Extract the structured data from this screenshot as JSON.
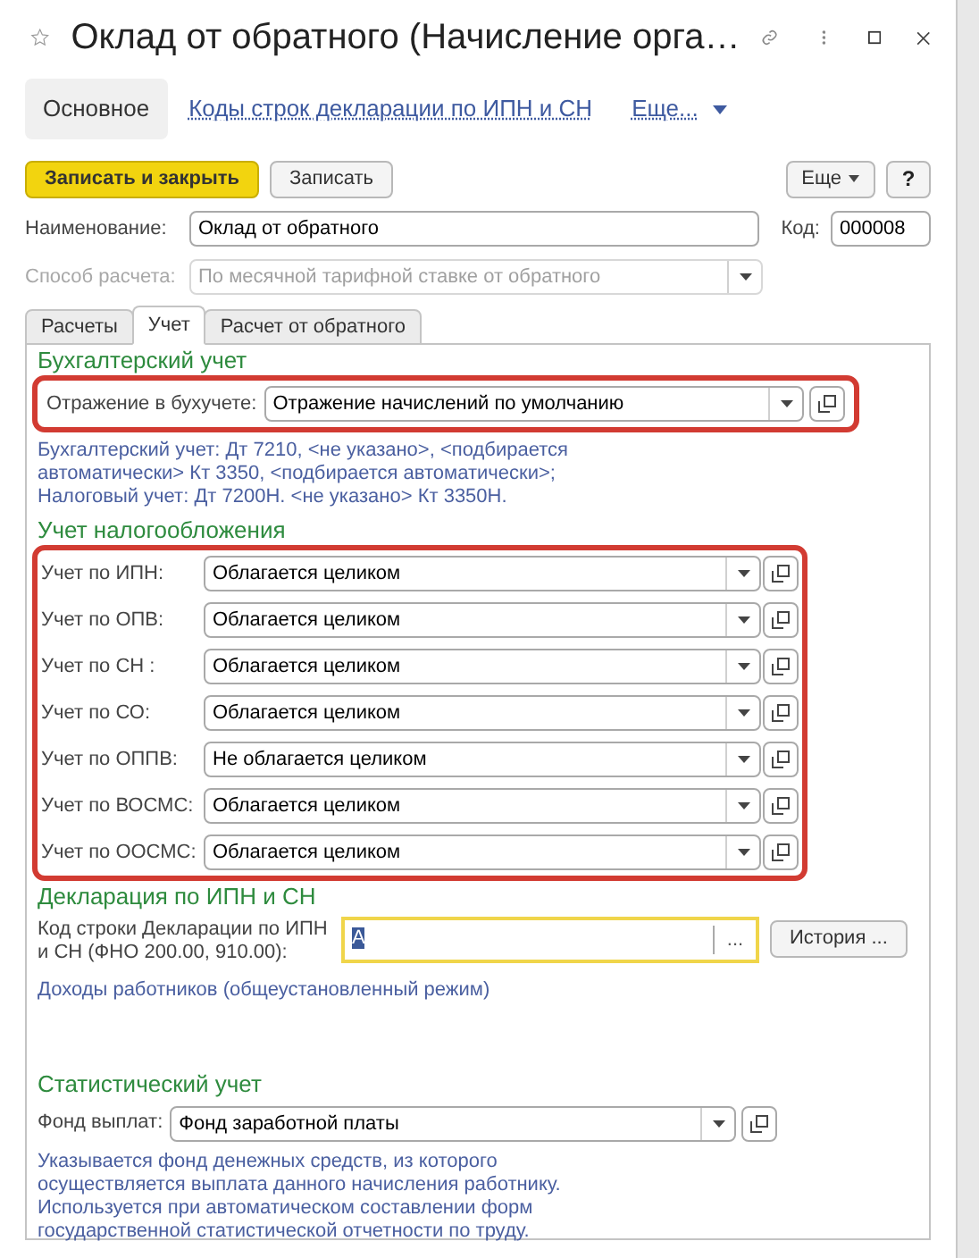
{
  "window": {
    "title": "Оклад от обратного (Начисление орга…",
    "favorite": false
  },
  "nav": [
    {
      "label": "Основное",
      "selected": true,
      "kind": "tab"
    },
    {
      "label": "Коды строк декларации по ИПН и СН",
      "selected": false,
      "kind": "link"
    },
    {
      "label": "Еще...",
      "selected": false,
      "kind": "menu"
    }
  ],
  "toolbar": {
    "primary": "Записать и закрыть",
    "secondary": "Записать",
    "more": "Еще",
    "help": "?"
  },
  "name_field": {
    "label": "Наименование:",
    "value": "Оклад от обратного"
  },
  "code_field": {
    "label": "Код:",
    "value": "000008"
  },
  "method_field": {
    "label": "Способ расчета:",
    "value": "По месячной тарифной ставке от обратного",
    "disabled": true
  },
  "tabs": [
    {
      "label": "Расчеты",
      "selected": false
    },
    {
      "label": "Учет",
      "selected": true
    },
    {
      "label": "Расчет от обратного",
      "selected": false
    }
  ],
  "accounting": {
    "heading": "Бухгалтерский учет",
    "highlighted": true,
    "field": {
      "label": "Отражение в бухучете:",
      "value": "Отражение начислений по умолчанию"
    },
    "hint_lines": [
      "Бухгалтерский учет: Дт 7210, <не указано>, <подбирается",
      "автоматически> Кт 3350, <подбирается автоматически>;",
      "Налоговый учет: Дт 7200Н. <не указано> Кт 3350Н."
    ]
  },
  "taxation": {
    "heading": "Учет налогообложения",
    "highlighted": true,
    "rows": [
      {
        "label": "Учет по ИПН:",
        "value": "Облагается целиком"
      },
      {
        "label": "Учет по ОПВ:",
        "value": "Облагается целиком"
      },
      {
        "label": "Учет по СН :",
        "value": "Облагается целиком"
      },
      {
        "label": "Учет по СО:",
        "value": "Облагается целиком"
      },
      {
        "label": "Учет по ОППВ:",
        "value": "Не облагается целиком"
      },
      {
        "label": "Учет по ВОСМС:",
        "value": "Облагается целиком"
      },
      {
        "label": "Учет по ООСМС:",
        "value": "Облагается целиком"
      }
    ]
  },
  "declaration": {
    "heading": "Декларация по ИПН и СН",
    "label_lines": [
      "Код строки Декларации по ИПН",
      "и СН (ФНО 200.00, 910.00):"
    ],
    "value": "А",
    "focused": true,
    "choose": "...",
    "history_button": "История ...",
    "link": "Доходы работников (общеустановленный режим)"
  },
  "statistics": {
    "heading": "Статистический учет",
    "field": {
      "label": "Фонд выплат:",
      "value": "Фонд заработной платы"
    },
    "hint_lines": [
      "Указывается фонд денежных средств, из которого",
      "осуществляется выплата данного начисления работнику.",
      "Используется при автоматическом составлении форм",
      "государственной статистической отчетности по труду."
    ]
  }
}
